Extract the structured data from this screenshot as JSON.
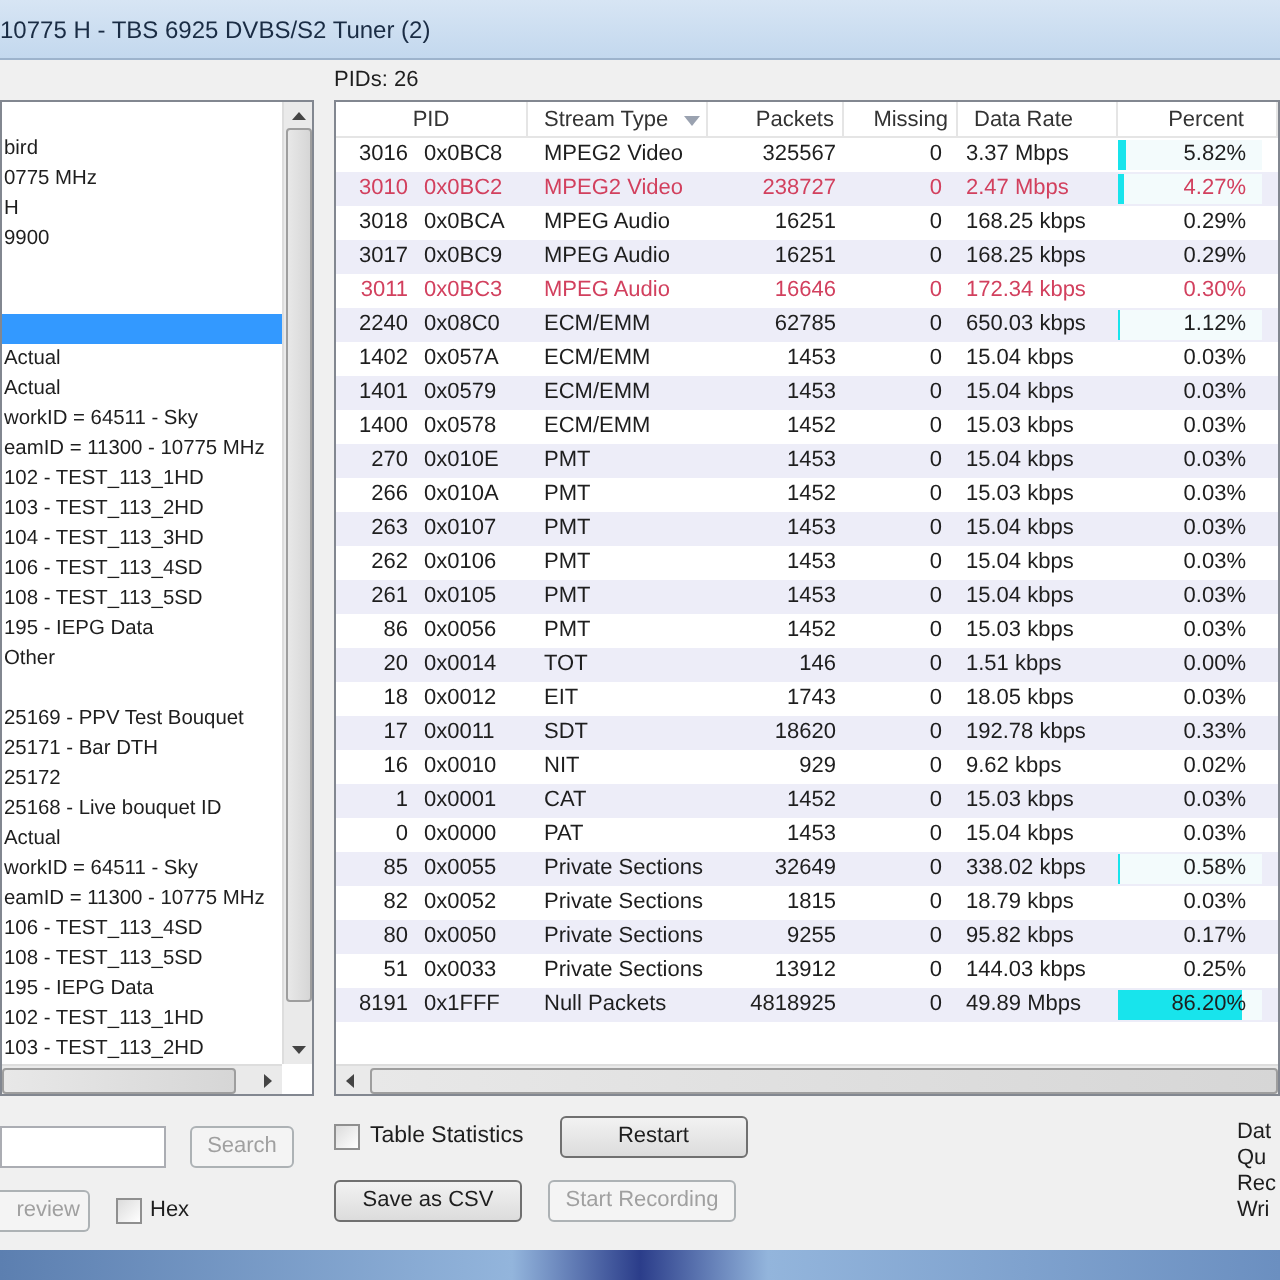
{
  "window": {
    "title": "10775 H - TBS 6925 DVBS/S2 Tuner (2)"
  },
  "tree": {
    "items": [
      {
        "selected": false
      },
      {
        "text": "bird",
        "selected": false
      },
      {
        "text": "0775 MHz",
        "selected": false
      },
      {
        "text": "H",
        "selected": false
      },
      {
        "text": "9900",
        "selected": false
      },
      {
        "selected": false
      },
      {
        "selected": false
      },
      {
        "selected": true
      },
      {
        "text": "Actual",
        "selected": false
      },
      {
        "text": "Actual",
        "selected": false
      },
      {
        "text": "workID = 64511 - Sky",
        "selected": false
      },
      {
        "text": "eamID = 11300 - 10775 MHz",
        "selected": false
      },
      {
        "text": "102 - TEST_113_1HD",
        "selected": false
      },
      {
        "text": "103 - TEST_113_2HD",
        "selected": false
      },
      {
        "text": "104 - TEST_113_3HD",
        "selected": false
      },
      {
        "text": "106 - TEST_113_4SD",
        "selected": false
      },
      {
        "text": "108 - TEST_113_5SD",
        "selected": false
      },
      {
        "text": "195 - IEPG Data",
        "selected": false
      },
      {
        "text": "Other",
        "selected": false
      },
      {
        "selected": false
      },
      {
        "text": "25169 - PPV Test Bouquet",
        "selected": false
      },
      {
        "text": "25171 - Bar DTH",
        "selected": false
      },
      {
        "text": "25172",
        "selected": false
      },
      {
        "text": "25168 - Live bouquet ID",
        "selected": false
      },
      {
        "text": "Actual",
        "selected": false
      },
      {
        "text": "workID = 64511 - Sky",
        "selected": false
      },
      {
        "text": "eamID = 11300 - 10775 MHz",
        "selected": false
      },
      {
        "text": "106 - TEST_113_4SD",
        "selected": false
      },
      {
        "text": "108 - TEST_113_5SD",
        "selected": false
      },
      {
        "text": "195 - IEPG Data",
        "selected": false
      },
      {
        "text": "102 - TEST_113_1HD",
        "selected": false
      },
      {
        "text": "103 - TEST_113_2HD",
        "selected": false
      }
    ]
  },
  "search_button": {
    "label": "Search",
    "disabled": true
  },
  "preview_button": {
    "label": "review",
    "disabled": true
  },
  "hex_checkbox": {
    "label": "Hex",
    "checked": false
  },
  "pid_count": "PIDs: 26",
  "table": {
    "columns": [
      {
        "label": "PID",
        "sorted": false
      },
      {
        "label": "Stream Type",
        "sorted": true
      },
      {
        "label": "Packets",
        "sorted": false
      },
      {
        "label": "Missing",
        "sorted": false
      },
      {
        "label": "Data Rate",
        "sorted": false
      },
      {
        "label": "Percent",
        "sorted": false
      }
    ],
    "rows": [
      {
        "pid": "3016",
        "hex": "0x0BC8",
        "type": "MPEG2 Video",
        "packets": "325567",
        "missing": "0",
        "rate": "3.37 Mbps",
        "percent": "5.82%",
        "level": 0.0582,
        "alert": false
      },
      {
        "pid": "3010",
        "hex": "0x0BC2",
        "type": "MPEG2 Video",
        "packets": "238727",
        "missing": "0",
        "rate": "2.47 Mbps",
        "percent": "4.27%",
        "level": 0.0427,
        "alert": true
      },
      {
        "pid": "3018",
        "hex": "0x0BCA",
        "type": "MPEG Audio",
        "packets": "16251",
        "missing": "0",
        "rate": "168.25 kbps",
        "percent": "0.29%",
        "alert": false
      },
      {
        "pid": "3017",
        "hex": "0x0BC9",
        "type": "MPEG Audio",
        "packets": "16251",
        "missing": "0",
        "rate": "168.25 kbps",
        "percent": "0.29%",
        "alert": false
      },
      {
        "pid": "3011",
        "hex": "0x0BC3",
        "type": "MPEG Audio",
        "packets": "16646",
        "missing": "0",
        "rate": "172.34 kbps",
        "percent": "0.30%",
        "alert": true
      },
      {
        "pid": "2240",
        "hex": "0x08C0",
        "type": "ECM/EMM",
        "packets": "62785",
        "missing": "0",
        "rate": "650.03 kbps",
        "percent": "1.12%",
        "level": 0.0112,
        "alert": false
      },
      {
        "pid": "1402",
        "hex": "0x057A",
        "type": "ECM/EMM",
        "packets": "1453",
        "missing": "0",
        "rate": "15.04 kbps",
        "percent": "0.03%",
        "alert": false
      },
      {
        "pid": "1401",
        "hex": "0x0579",
        "type": "ECM/EMM",
        "packets": "1453",
        "missing": "0",
        "rate": "15.04 kbps",
        "percent": "0.03%",
        "alert": false
      },
      {
        "pid": "1400",
        "hex": "0x0578",
        "type": "ECM/EMM",
        "packets": "1452",
        "missing": "0",
        "rate": "15.03 kbps",
        "percent": "0.03%",
        "alert": false
      },
      {
        "pid": "270",
        "hex": "0x010E",
        "type": "PMT",
        "packets": "1453",
        "missing": "0",
        "rate": "15.04 kbps",
        "percent": "0.03%",
        "alert": false
      },
      {
        "pid": "266",
        "hex": "0x010A",
        "type": "PMT",
        "packets": "1452",
        "missing": "0",
        "rate": "15.03 kbps",
        "percent": "0.03%",
        "alert": false
      },
      {
        "pid": "263",
        "hex": "0x0107",
        "type": "PMT",
        "packets": "1453",
        "missing": "0",
        "rate": "15.04 kbps",
        "percent": "0.03%",
        "alert": false
      },
      {
        "pid": "262",
        "hex": "0x0106",
        "type": "PMT",
        "packets": "1453",
        "missing": "0",
        "rate": "15.04 kbps",
        "percent": "0.03%",
        "alert": false
      },
      {
        "pid": "261",
        "hex": "0x0105",
        "type": "PMT",
        "packets": "1453",
        "missing": "0",
        "rate": "15.04 kbps",
        "percent": "0.03%",
        "alert": false
      },
      {
        "pid": "86",
        "hex": "0x0056",
        "type": "PMT",
        "packets": "1452",
        "missing": "0",
        "rate": "15.03 kbps",
        "percent": "0.03%",
        "alert": false
      },
      {
        "pid": "20",
        "hex": "0x0014",
        "type": "TOT",
        "packets": "146",
        "missing": "0",
        "rate": "1.51 kbps",
        "percent": "0.00%",
        "alert": false
      },
      {
        "pid": "18",
        "hex": "0x0012",
        "type": "EIT",
        "packets": "1743",
        "missing": "0",
        "rate": "18.05 kbps",
        "percent": "0.03%",
        "alert": false
      },
      {
        "pid": "17",
        "hex": "0x0011",
        "type": "SDT",
        "packets": "18620",
        "missing": "0",
        "rate": "192.78 kbps",
        "percent": "0.33%",
        "alert": false
      },
      {
        "pid": "16",
        "hex": "0x0010",
        "type": "NIT",
        "packets": "929",
        "missing": "0",
        "rate": "9.62 kbps",
        "percent": "0.02%",
        "alert": false
      },
      {
        "pid": "1",
        "hex": "0x0001",
        "type": "CAT",
        "packets": "1452",
        "missing": "0",
        "rate": "15.03 kbps",
        "percent": "0.03%",
        "alert": false
      },
      {
        "pid": "0",
        "hex": "0x0000",
        "type": "PAT",
        "packets": "1453",
        "missing": "0",
        "rate": "15.04 kbps",
        "percent": "0.03%",
        "alert": false
      },
      {
        "pid": "85",
        "hex": "0x0055",
        "type": "Private Sections",
        "packets": "32649",
        "missing": "0",
        "rate": "338.02 kbps",
        "percent": "0.58%",
        "level": 0.0058,
        "alert": false
      },
      {
        "pid": "82",
        "hex": "0x0052",
        "type": "Private Sections",
        "packets": "1815",
        "missing": "0",
        "rate": "18.79 kbps",
        "percent": "0.03%",
        "alert": false
      },
      {
        "pid": "80",
        "hex": "0x0050",
        "type": "Private Sections",
        "packets": "9255",
        "missing": "0",
        "rate": "95.82 kbps",
        "percent": "0.17%",
        "alert": false
      },
      {
        "pid": "51",
        "hex": "0x0033",
        "type": "Private Sections",
        "packets": "13912",
        "missing": "0",
        "rate": "144.03 kbps",
        "percent": "0.25%",
        "alert": false
      },
      {
        "pid": "8191",
        "hex": "0x1FFF",
        "type": "Null Packets",
        "packets": "4818925",
        "missing": "0",
        "rate": "49.89 Mbps",
        "percent": "86.20%",
        "level": 0.862,
        "alert": false
      }
    ]
  },
  "table_statistics_checkbox": {
    "label": "Table Statistics",
    "checked": false
  },
  "restart_button": {
    "label": "Restart",
    "disabled": false
  },
  "save_csv_button": {
    "label": "Save as CSV",
    "disabled": false
  },
  "start_recording_button": {
    "label": "Start Recording",
    "disabled": true
  },
  "side_labels": [
    "Dat",
    "Qu",
    "Rec",
    "Wri"
  ]
}
